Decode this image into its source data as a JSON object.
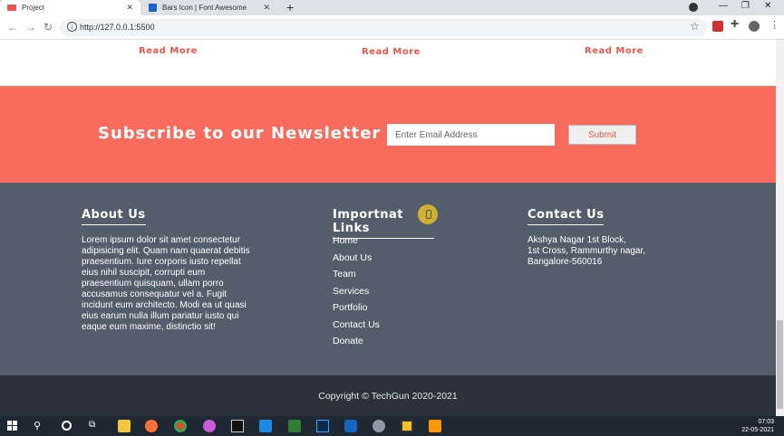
{
  "browser": {
    "tabs": [
      {
        "title": "Project",
        "active": true,
        "favicon_color": "#e8574d"
      },
      {
        "title": "Bars Icon | Font Awesome",
        "active": false,
        "favicon_color": "#1c62c9"
      }
    ],
    "new_tab_symbol": "+",
    "close_symbol": "✕",
    "url": "http://127.0.0.1:5500",
    "window_controls": {
      "minimize": "—",
      "restore": "❐",
      "close": "✕"
    }
  },
  "page": {
    "read_more": [
      "Read More",
      "Read More",
      "Read More"
    ],
    "newsletter": {
      "title": "Subscribe to our Newsletter",
      "email_placeholder": "Enter Email Address",
      "submit_label": "Submit",
      "bg_color": "#f96b5d"
    },
    "footer": {
      "about": {
        "heading": "About Us",
        "text": "Lorem ipsum dolor sit amet consectetur adipisicing elit. Quam nam quaerat debitis praesentium. Iure corporis iusto repellat eius nihil suscipit, corrupti eum praesentium quisquam, ullam porro accusamus consequatur vel a. Fugit incidunt eum architecto. Modi ea ut quasi eius earum nulla illum pariatur iusto qui eaque eum maxime, distinctio sit!"
      },
      "links": {
        "heading": "Importnat Links",
        "items": [
          "Home",
          "About Us",
          "Team",
          "Services",
          "Portfolio",
          "Contact Us",
          "Donate"
        ]
      },
      "contact": {
        "heading": "Contact Us",
        "lines": [
          "Akshya Nagar 1st Block,",
          "1st Cross, Rammurthy nagar,",
          "Bangalore-560016"
        ]
      },
      "copyright": "Copyright © TechGun 2020-2021",
      "bg_color": "#535d6b",
      "bottom_color": "#2c323c"
    }
  },
  "taskbar": {
    "time": "07:03",
    "date": "22-05-2021",
    "apps": [
      "windows-start",
      "search",
      "cortana",
      "task-view",
      "file-explorer",
      "firefox",
      "chrome",
      "edge-canary",
      "notion",
      "vscode",
      "sublime-ish",
      "photoshop",
      "app-blue",
      "paint",
      "sticky",
      "sublime"
    ]
  }
}
